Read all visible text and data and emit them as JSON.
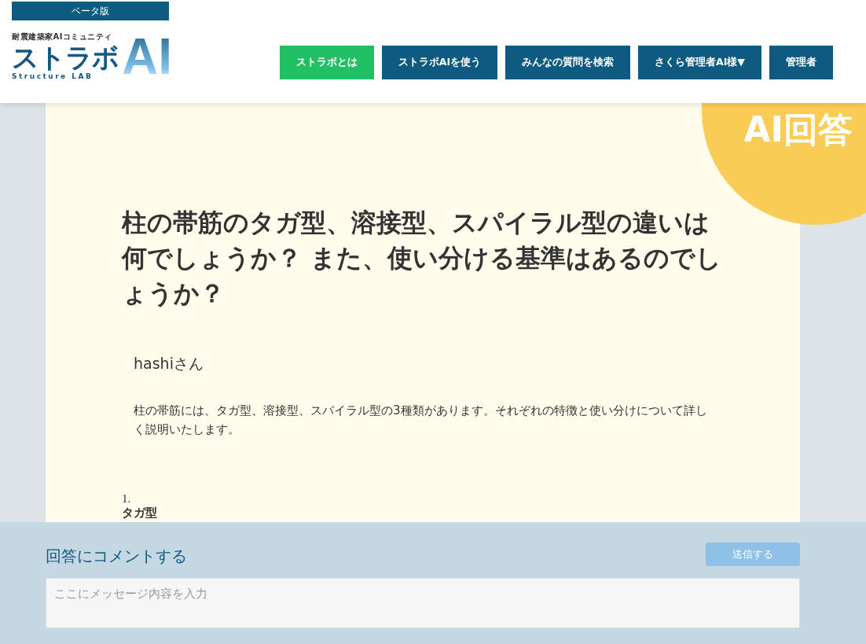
{
  "header": {
    "beta_badge": "ベータ版",
    "logo": {
      "tagline": "耐震建築家AIコミュニティ",
      "name": "ストラボ",
      "subtitle": "Structure LAB",
      "mark": "AI"
    },
    "nav": [
      {
        "label": "ストラボとは",
        "selected": true
      },
      {
        "label": "ストラボAIを使う",
        "selected": false
      },
      {
        "label": "みんなの質問を検索",
        "selected": false
      },
      {
        "label": "さくら管理者AI様▼",
        "selected": false
      },
      {
        "label": "管理者",
        "selected": false
      }
    ]
  },
  "answer_badge": "AI回答",
  "question": {
    "title": "柱の帯筋のタガ型、溶接型、スパイラル型の違いは何でしょうか？ また、使い分ける基準はあるのでしょうか？",
    "author": "hashiさん",
    "body": "柱の帯筋には、タガ型、溶接型、スパイラル型の3種類があります。それぞれの特徴と使い分けについて詳しく説明いたします。",
    "list": [
      {
        "number": "1.",
        "heading": "タガ型"
      }
    ]
  },
  "comment": {
    "title": "回答にコメントする",
    "send_button": "送信する",
    "placeholder": "ここにメッセージ内容を入力"
  }
}
